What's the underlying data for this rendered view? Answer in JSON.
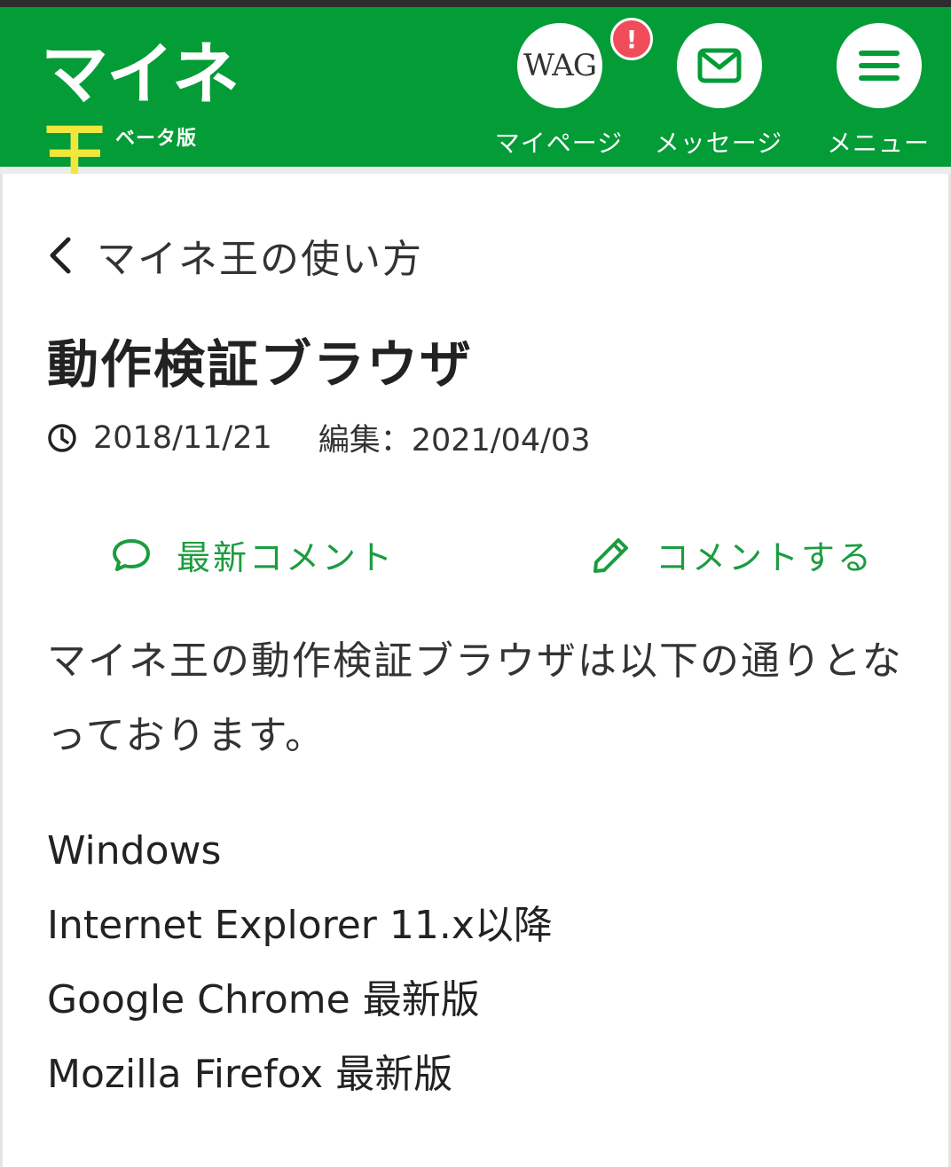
{
  "header": {
    "logo_text": "マイネ",
    "logo_text_accent": "王",
    "logo_sub": "ベータ版",
    "mypage": {
      "avatar_text": "WAG",
      "badge": "!",
      "label": "マイページ"
    },
    "messages": {
      "label": "メッセージ"
    },
    "menu": {
      "label": "メニュー"
    },
    "colors": {
      "brand": "#049c37",
      "badge": "#f04c5a",
      "accent": "#f2e63a"
    }
  },
  "article": {
    "breadcrumb": "マイネ王の使い方",
    "title": "動作検証ブラウザ",
    "posted_date": "2018/11/21",
    "edited": "編集：2021/04/03",
    "actions": {
      "latest_comments": "最新コメント",
      "write_comment": "コメントする",
      "color": "#1c9c3f"
    },
    "intro": "マイネ王の動作検証ブラウザは以下の通りとなっております。",
    "browsers": [
      "Windows",
      "Internet Explorer 11.x以降",
      "Google Chrome 最新版",
      "Mozilla Firefox 最新版"
    ]
  }
}
